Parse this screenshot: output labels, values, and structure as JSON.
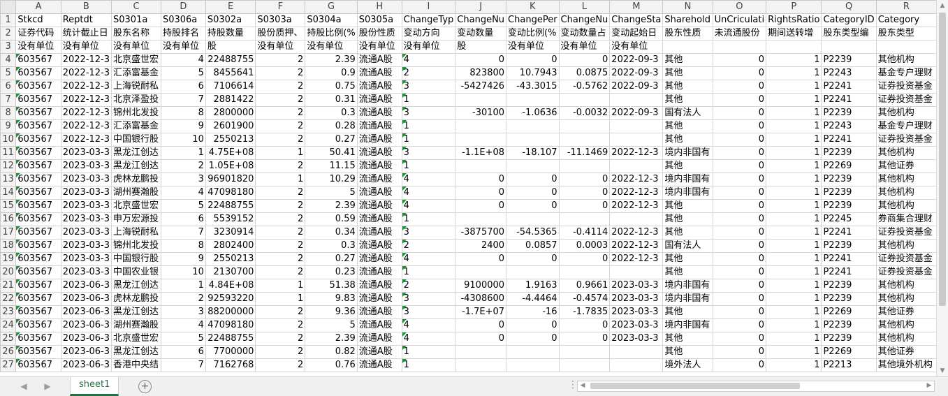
{
  "columns": [
    "A",
    "B",
    "C",
    "D",
    "E",
    "F",
    "G",
    "H",
    "I",
    "J",
    "K",
    "L",
    "M",
    "N",
    "O",
    "P",
    "Q",
    "R"
  ],
  "numeric_cols": [
    3,
    4,
    5,
    6,
    9,
    10,
    11,
    14,
    15
  ],
  "green_cols": [
    0,
    8
  ],
  "rows": [
    [
      "Stkcd",
      "Reptdt",
      "S0301a",
      "S0306a",
      "S0302a",
      "S0303a",
      "S0304a",
      "S0305a",
      "ChangeTyp",
      "ChangeNu",
      "ChangePer",
      "ChangeNu",
      "ChangeSta",
      "Sharehold",
      "UnCriculati",
      "RightsRatio",
      "CategoryID",
      "Category"
    ],
    [
      "证券代码",
      "统计截止日",
      "股东名称",
      "持股排名",
      "持股数量",
      "股份质押、",
      "持股比例(%",
      "股份性质",
      "变动方向",
      "变动数量",
      "变动比例(%",
      "变动数量占",
      "变动起始日",
      "股东性质",
      "未流通股份",
      "期间送转增",
      "股东类型编",
      "股东类型"
    ],
    [
      "没有单位",
      "没有单位",
      "没有单位",
      "没有单位",
      "股",
      "没有单位",
      "没有单位",
      "没有单位",
      "没有单位",
      "股",
      "没有单位",
      "没有单位",
      "没有单位",
      "",
      "",
      "",
      "",
      ""
    ],
    [
      "603567",
      "2022-12-3",
      "北京盛世宏",
      "4",
      "22488755",
      "2",
      "2.39",
      "流通A股",
      "4",
      "0",
      "0",
      "0",
      "2022-09-3",
      "其他",
      "0",
      "1",
      "P2239",
      "其他机构"
    ],
    [
      "603567",
      "2022-12-3",
      "汇添富基金",
      "5",
      "8455641",
      "2",
      "0.9",
      "流通A股",
      "2",
      "823800",
      "10.7943",
      "0.0875",
      "2022-09-3",
      "其他",
      "0",
      "1",
      "P2243",
      "基金专户理财"
    ],
    [
      "603567",
      "2022-12-3",
      "上海锐耐私",
      "6",
      "7106614",
      "2",
      "0.75",
      "流通A股",
      "3",
      "-5427426",
      "-43.3015",
      "-0.5762",
      "2022-09-3",
      "其他",
      "0",
      "1",
      "P2241",
      "证券投资基金"
    ],
    [
      "603567",
      "2022-12-3",
      "北京泽盈投",
      "7",
      "2881422",
      "2",
      "0.31",
      "流通A股",
      "1",
      "",
      "",
      "",
      "",
      "其他",
      "0",
      "1",
      "P2241",
      "证券投资基金"
    ],
    [
      "603567",
      "2022-12-3",
      "锦州北发投",
      "8",
      "2800000",
      "2",
      "0.3",
      "流通A股",
      "3",
      "-30100",
      "-1.0636",
      "-0.0032",
      "2022-09-3",
      "国有法人",
      "0",
      "1",
      "P2239",
      "其他机构"
    ],
    [
      "603567",
      "2022-12-3",
      "汇添富基金",
      "9",
      "2601900",
      "2",
      "0.28",
      "流通A股",
      "1",
      "",
      "",
      "",
      "",
      "其他",
      "0",
      "1",
      "P2243",
      "基金专户理财"
    ],
    [
      "603567",
      "2022-12-3",
      "中国银行股",
      "10",
      "2550213",
      "2",
      "0.27",
      "流通A股",
      "1",
      "",
      "",
      "",
      "",
      "其他",
      "0",
      "1",
      "P2241",
      "证券投资基金"
    ],
    [
      "603567",
      "2023-03-3",
      "黑龙江创达",
      "1",
      "4.75E+08",
      "1",
      "50.41",
      "流通A股",
      "3",
      "-1.1E+08",
      "-18.107",
      "-11.1469",
      "2022-12-3",
      "境内非国有",
      "0",
      "1",
      "P2239",
      "其他机构"
    ],
    [
      "603567",
      "2023-03-3",
      "黑龙江创达",
      "2",
      "1.05E+08",
      "2",
      "11.15",
      "流通A股",
      "1",
      "",
      "",
      "",
      "",
      "其他",
      "0",
      "1",
      "P2269",
      "其他证券"
    ],
    [
      "603567",
      "2023-03-3",
      "虎林龙鹏投",
      "3",
      "96901820",
      "1",
      "10.29",
      "流通A股",
      "4",
      "0",
      "0",
      "0",
      "2022-12-3",
      "境内非国有",
      "0",
      "1",
      "P2239",
      "其他机构"
    ],
    [
      "603567",
      "2023-03-3",
      "湖州赛瀚股",
      "4",
      "47098180",
      "2",
      "5",
      "流通A股",
      "4",
      "0",
      "0",
      "0",
      "2022-12-3",
      "境内非国有",
      "0",
      "1",
      "P2239",
      "其他机构"
    ],
    [
      "603567",
      "2023-03-3",
      "北京盛世宏",
      "5",
      "22488755",
      "2",
      "2.39",
      "流通A股",
      "4",
      "0",
      "0",
      "0",
      "2022-12-3",
      "其他",
      "0",
      "1",
      "P2239",
      "其他机构"
    ],
    [
      "603567",
      "2023-03-3",
      "申万宏源投",
      "6",
      "5539152",
      "2",
      "0.59",
      "流通A股",
      "1",
      "",
      "",
      "",
      "",
      "其他",
      "0",
      "1",
      "P2245",
      "券商集合理财"
    ],
    [
      "603567",
      "2023-03-3",
      "上海锐耐私",
      "7",
      "3230914",
      "2",
      "0.34",
      "流通A股",
      "3",
      "-3875700",
      "-54.5365",
      "-0.4114",
      "2022-12-3",
      "其他",
      "0",
      "1",
      "P2241",
      "证券投资基金"
    ],
    [
      "603567",
      "2023-03-3",
      "锦州北发投",
      "8",
      "2802400",
      "2",
      "0.3",
      "流通A股",
      "2",
      "2400",
      "0.0857",
      "0.0003",
      "2022-12-3",
      "国有法人",
      "0",
      "1",
      "P2239",
      "其他机构"
    ],
    [
      "603567",
      "2023-03-3",
      "中国银行股",
      "9",
      "2550213",
      "2",
      "0.27",
      "流通A股",
      "4",
      "0",
      "0",
      "0",
      "2022-12-3",
      "其他",
      "0",
      "1",
      "P2241",
      "证券投资基金"
    ],
    [
      "603567",
      "2023-03-3",
      "中国农业银",
      "10",
      "2130700",
      "2",
      "0.23",
      "流通A股",
      "1",
      "",
      "",
      "",
      "",
      "其他",
      "0",
      "1",
      "P2241",
      "证券投资基金"
    ],
    [
      "603567",
      "2023-06-3",
      "黑龙江创达",
      "1",
      "4.84E+08",
      "1",
      "51.38",
      "流通A股",
      "2",
      "9100000",
      "1.9163",
      "0.9661",
      "2023-03-3",
      "境内非国有",
      "0",
      "1",
      "P2239",
      "其他机构"
    ],
    [
      "603567",
      "2023-06-3",
      "虎林龙鹏投",
      "2",
      "92593220",
      "1",
      "9.83",
      "流通A股",
      "3",
      "-4308600",
      "-4.4464",
      "-0.4574",
      "2023-03-3",
      "境内非国有",
      "0",
      "1",
      "P2239",
      "其他机构"
    ],
    [
      "603567",
      "2023-06-3",
      "黑龙江创达",
      "3",
      "88200000",
      "2",
      "9.36",
      "流通A股",
      "3",
      "-1.7E+07",
      "-16",
      "-1.7835",
      "2023-03-3",
      "其他",
      "0",
      "1",
      "P2269",
      "其他证券"
    ],
    [
      "603567",
      "2023-06-3",
      "湖州赛瀚股",
      "4",
      "47098180",
      "2",
      "5",
      "流通A股",
      "4",
      "0",
      "0",
      "0",
      "2023-03-3",
      "境内非国有",
      "0",
      "1",
      "P2239",
      "其他机构"
    ],
    [
      "603567",
      "2023-06-3",
      "北京盛世宏",
      "5",
      "22488755",
      "2",
      "2.39",
      "流通A股",
      "4",
      "0",
      "0",
      "0",
      "2023-03-3",
      "其他",
      "0",
      "1",
      "P2239",
      "其他机构"
    ],
    [
      "603567",
      "2023-06-3",
      "黑龙江创达",
      "6",
      "7700000",
      "2",
      "0.82",
      "流通A股",
      "1",
      "",
      "",
      "",
      "",
      "其他",
      "0",
      "1",
      "P2269",
      "其他证券"
    ],
    [
      "603567",
      "2023-06-3",
      "香港中央结",
      "7",
      "7162768",
      "2",
      "0.76",
      "流通A股",
      "1",
      "",
      "",
      "",
      "",
      "境外法人",
      "0",
      "1",
      "P2213",
      "其他境外机构"
    ]
  ],
  "sheet_tab": "sheet1",
  "add_sheet_label": "+",
  "hscroll_dots": "⋮",
  "nav_prev": "◀",
  "nav_next": "▶",
  "icons": {
    "add_sheet": "plus-circle-icon",
    "prev": "prev-arrow-icon",
    "next": "next-arrow-icon"
  }
}
